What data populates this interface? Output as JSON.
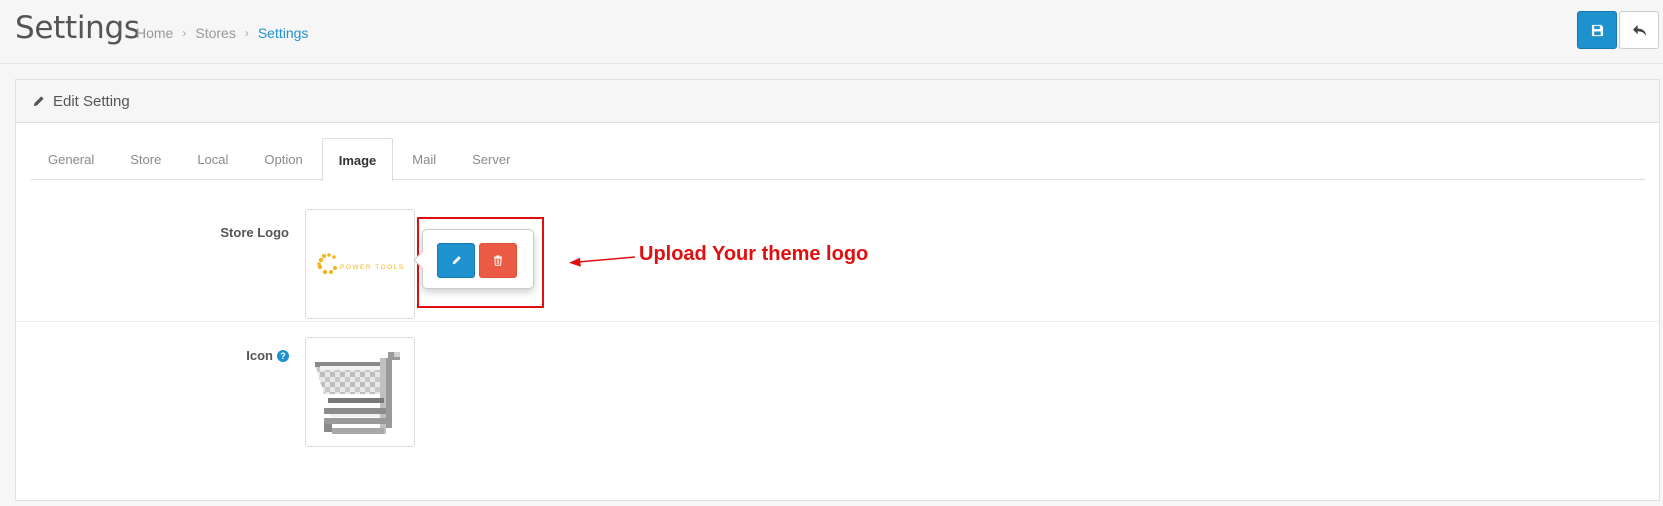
{
  "header": {
    "title": "Settings",
    "breadcrumb": [
      "Home",
      "Stores",
      "Settings"
    ],
    "save_icon": "save-icon",
    "back_icon": "reply-icon"
  },
  "panel": {
    "title": "Edit Setting",
    "title_icon": "pencil-icon"
  },
  "tabs": [
    {
      "label": "General",
      "active": false
    },
    {
      "label": "Store",
      "active": false
    },
    {
      "label": "Local",
      "active": false
    },
    {
      "label": "Option",
      "active": false
    },
    {
      "label": "Image",
      "active": true
    },
    {
      "label": "Mail",
      "active": false
    },
    {
      "label": "Server",
      "active": false
    }
  ],
  "fields": {
    "store_logo": {
      "label": "Store Logo",
      "logo_text": "POWER TOOLS",
      "edit_icon": "pencil-icon",
      "clear_icon": "trash-icon"
    },
    "icon": {
      "label": "Icon",
      "help_icon": "question-circle-icon",
      "help_glyph": "?",
      "image": "shopping-cart-icon"
    }
  },
  "annotation": {
    "text": "Upload Your theme logo",
    "color": "#e01010"
  },
  "colors": {
    "primary": "#1e91cf",
    "danger": "#ea5a44",
    "logo_accent": "#f4b41a"
  }
}
